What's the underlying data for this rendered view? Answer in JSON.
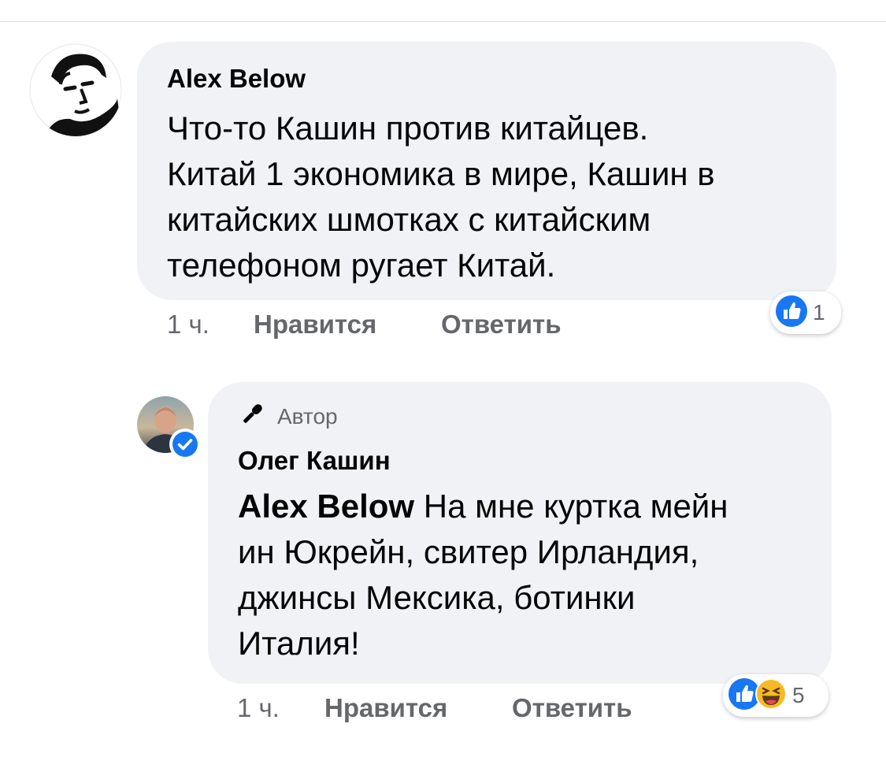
{
  "comment1": {
    "author": "Alex Below",
    "body_lines": [
      "Что-то Кашин против китайцев.",
      "Китай 1 экономика в мире, Кашин в",
      "китайских шмотках с китайским",
      "телефоном ругает Китай."
    ],
    "time": "1 ч.",
    "like_label": "Нравится",
    "reply_label": "Ответить",
    "reactions": {
      "icons": [
        "like-icon"
      ],
      "count": "1"
    }
  },
  "comment2": {
    "author_tag": "Автор",
    "author": "Олег Кашин",
    "verified": true,
    "mention": "Alex Below",
    "body_line1_rest": " На мне куртка мейн",
    "body_lines": [
      "ин Юкрейн, свитер Ирландия,",
      "джинсы Мексика, ботинки",
      "Италия!"
    ],
    "time": "1 ч.",
    "like_label": "Нравится",
    "reply_label": "Ответить",
    "reactions": {
      "icons": [
        "like-icon",
        "laugh-emoji-icon"
      ],
      "count": "5"
    }
  },
  "colors": {
    "bubble": "#f0f2f5",
    "meta_text": "#65676b",
    "like_blue": "#1877f2",
    "laugh_yellow": "#f7b928"
  }
}
